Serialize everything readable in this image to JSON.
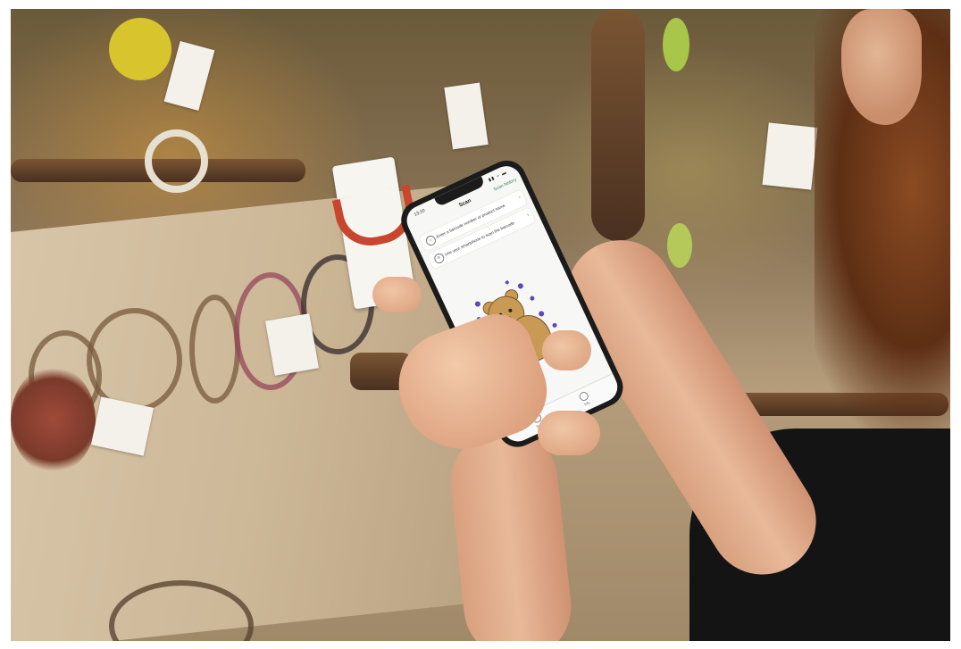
{
  "phone": {
    "status_time": "13:10",
    "status_icons": "▮▮ ⌁ ▬",
    "nav_title": "Scan",
    "nav_action": "Scan history",
    "list": [
      {
        "icon": "search-icon",
        "icon_glyph": "⌕",
        "label": "Enter a barcode number or product name",
        "chevron": "›"
      },
      {
        "icon": "barcode-icon",
        "icon_glyph": "≡",
        "label": "Use your smartphone to scan the barcode",
        "chevron": "›"
      }
    ],
    "tabbar": [
      {
        "icon": "scan-icon",
        "label": "Scan"
      },
      {
        "icon": "info-icon",
        "label": "Info"
      }
    ],
    "flag_glyph": "★",
    "colors": {
      "accent": "#2a8c4a",
      "eu_blue": "#1f3d96"
    }
  },
  "scene": {
    "hook_color": "#c8462d",
    "shirt_color": "#141414"
  }
}
